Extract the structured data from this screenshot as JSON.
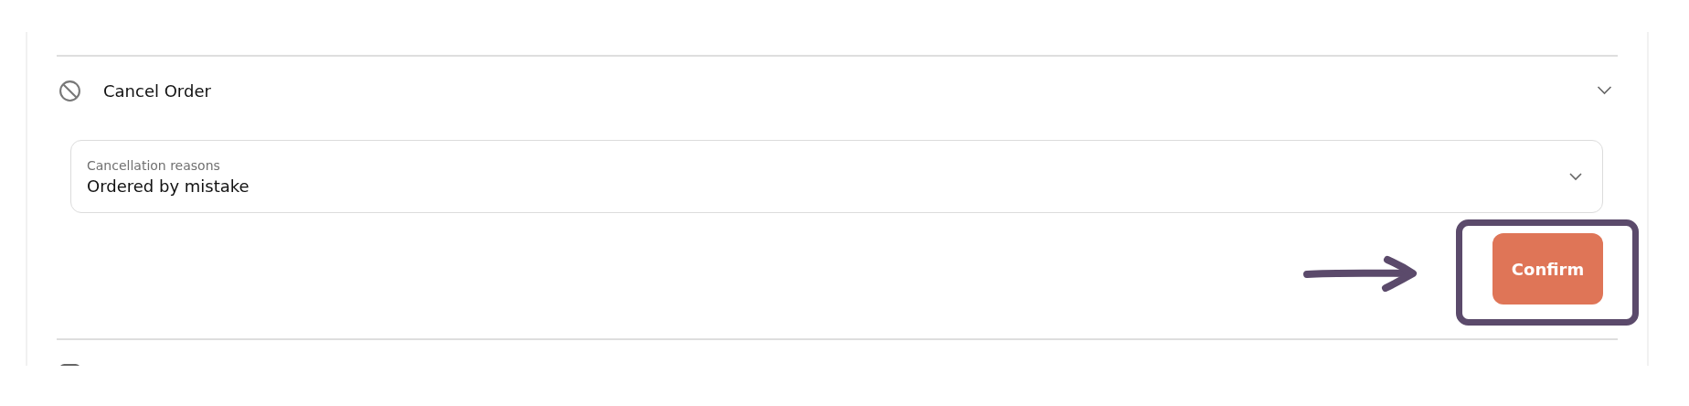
{
  "sections": [
    {
      "kind": "cancel",
      "title": "Cancel Order",
      "field": {
        "label": "Cancellation reasons",
        "value": "Ordered by mistake"
      },
      "button": "Confirm"
    },
    {
      "kind": "box"
    }
  ]
}
